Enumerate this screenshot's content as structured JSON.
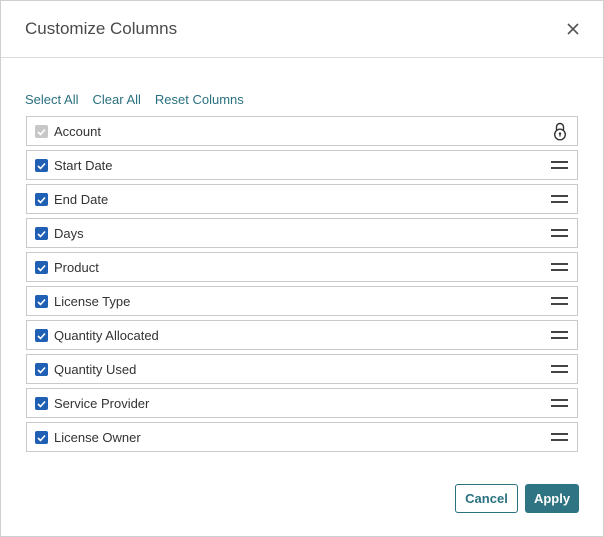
{
  "dialog": {
    "title": "Customize Columns",
    "close_icon": "close-icon"
  },
  "actions": {
    "select_all": "Select All",
    "clear_all": "Clear All",
    "reset_columns": "Reset Columns"
  },
  "columns": [
    {
      "label": "Account",
      "checked": true,
      "locked": true
    },
    {
      "label": "Start Date",
      "checked": true,
      "locked": false
    },
    {
      "label": "End Date",
      "checked": true,
      "locked": false
    },
    {
      "label": "Days",
      "checked": true,
      "locked": false
    },
    {
      "label": "Product",
      "checked": true,
      "locked": false
    },
    {
      "label": "License Type",
      "checked": true,
      "locked": false
    },
    {
      "label": "Quantity Allocated",
      "checked": true,
      "locked": false
    },
    {
      "label": "Quantity Used",
      "checked": true,
      "locked": false
    },
    {
      "label": "Service Provider",
      "checked": true,
      "locked": false
    },
    {
      "label": "License Owner",
      "checked": true,
      "locked": false
    }
  ],
  "footer": {
    "cancel_label": "Cancel",
    "apply_label": "Apply"
  },
  "colors": {
    "accent": "#2f7482",
    "link": "#2a7180",
    "checkbox": "#1f5fb4",
    "checkbox_disabled": "#c7c7c7"
  }
}
